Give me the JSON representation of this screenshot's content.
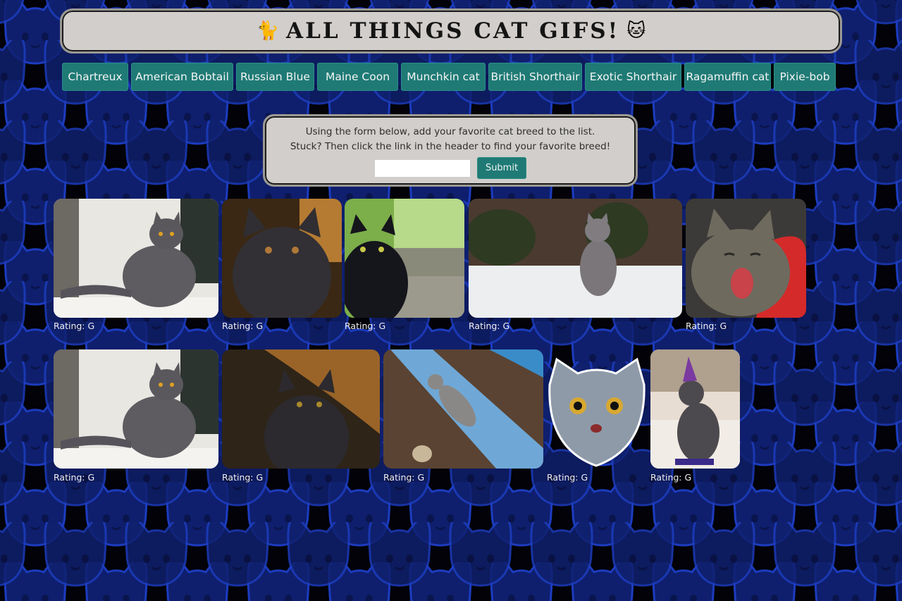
{
  "header": {
    "emoji_left": "🐈",
    "title": "ALL THINGS CAT GIFS!",
    "emoji_right": "🐱"
  },
  "nav": {
    "breeds": [
      "Chartreux",
      "American Bobtail",
      "Russian Blue",
      "Maine Coon",
      "Munchkin cat",
      "British Shorthair",
      "Exotic Shorthair",
      "Ragamuffin cat",
      "Pixie-bob"
    ]
  },
  "form": {
    "line1": "Using the form below, add your favorite cat breed to the list.",
    "line2": "Stuck? Then click the link in the header to find your favorite breed!",
    "input_value": "",
    "submit_label": "Submit"
  },
  "gifs": [
    {
      "rating": "Rating: G"
    },
    {
      "rating": "Rating: G"
    },
    {
      "rating": "Rating: G"
    },
    {
      "rating": "Rating: G"
    },
    {
      "rating": "Rating: G"
    },
    {
      "rating": "Rating: G"
    },
    {
      "rating": "Rating: G"
    },
    {
      "rating": "Rating: G"
    },
    {
      "rating": "Rating: G"
    },
    {
      "rating": "Rating: G"
    }
  ],
  "colors": {
    "background": "#020208",
    "pattern": "#10237a",
    "button": "#1f7a75",
    "panel": "#d1cecb"
  }
}
